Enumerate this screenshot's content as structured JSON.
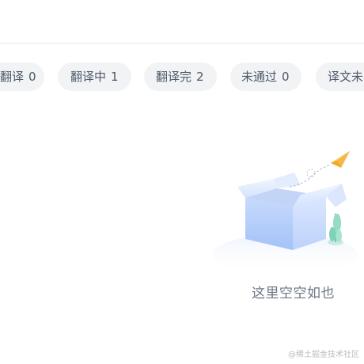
{
  "tabs": [
    {
      "label": "翻译",
      "count": "0"
    },
    {
      "label": "翻译中",
      "count": "1"
    },
    {
      "label": "翻译完",
      "count": "2"
    },
    {
      "label": "未通过",
      "count": "0"
    },
    {
      "label": "译文未",
      "count": ""
    }
  ],
  "empty_state": {
    "message": "这里空空如也"
  },
  "watermark": "@稀土掘金技术社区",
  "icons": {
    "illustration": "empty-box-with-paper-plane"
  },
  "colors": {
    "tab_bg": "#f2f3f5",
    "tab_text": "#4e5969",
    "empty_text": "#6b7785",
    "box_blue": "#a9c7fb",
    "plane_orange": "#f5a623",
    "plant_green": "#86d6c1"
  }
}
